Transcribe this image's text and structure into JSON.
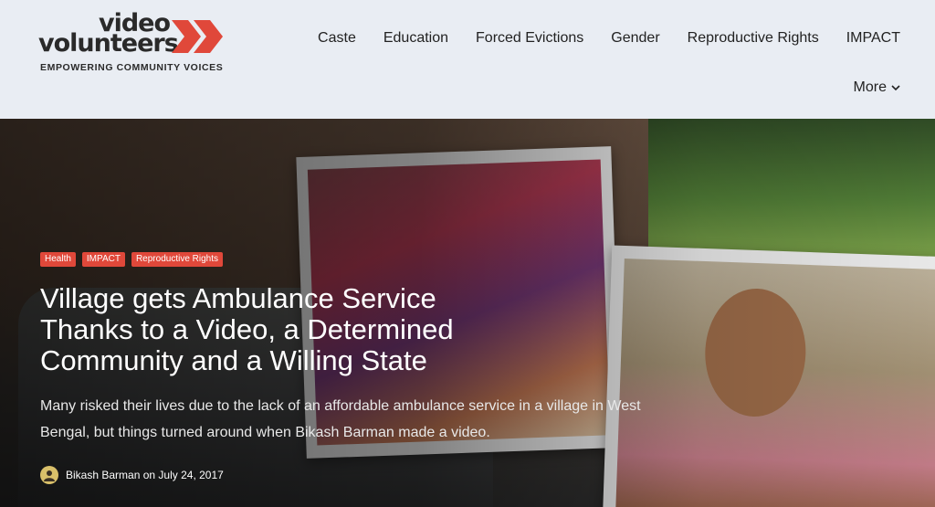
{
  "logo": {
    "line1": "video",
    "line2": "volunteers",
    "tagline": "EMPOWERING COMMUNITY VOICES",
    "accent_color": "#e0483a"
  },
  "nav": {
    "items": [
      "Caste",
      "Education",
      "Forced Evictions",
      "Gender",
      "Reproductive Rights",
      "IMPACT"
    ],
    "more_label": "More",
    "more_icon": "chevron-down-icon"
  },
  "article": {
    "tags": [
      "Health",
      "IMPACT",
      "Reproductive Rights"
    ],
    "title": "Village gets Ambulance Service Thanks to a Video, a Determined Community and a Willing State",
    "excerpt": "Many risked their lives due to the lack of an affordable ambulance service in a village in West Bengal, but things turned around when Bikash Barman made a video.",
    "author": "Bikash Barman",
    "date_prefix": "on",
    "date": "July 24, 2017"
  }
}
